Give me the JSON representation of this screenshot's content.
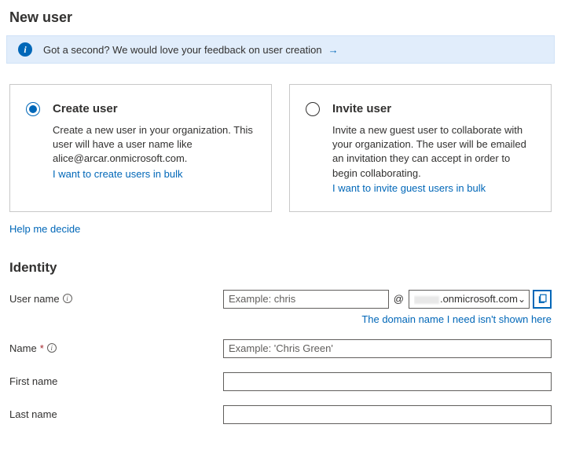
{
  "pageTitle": "New user",
  "feedback": {
    "text": "Got a second? We would love your feedback on user creation",
    "arrow": "→"
  },
  "cards": {
    "create": {
      "title": "Create user",
      "desc": "Create a new user in your organization. This user will have a user name like alice@arcar.onmicrosoft.com.",
      "link": "I want to create users in bulk"
    },
    "invite": {
      "title": "Invite user",
      "desc": "Invite a new guest user to collaborate with your organization. The user will be emailed an invitation they can accept in order to begin collaborating.",
      "link": "I want to invite guest users in bulk"
    }
  },
  "helpLink": "Help me decide",
  "section": "Identity",
  "labels": {
    "username": "User name",
    "name": "Name",
    "firstname": "First name",
    "lastname": "Last name"
  },
  "placeholders": {
    "username": "Example: chris",
    "name": "Example: 'Chris Green'"
  },
  "domain": {
    "suffix": ".onmicrosoft.com",
    "at": "@",
    "helpLink": "The domain name I need isn't shown here"
  }
}
